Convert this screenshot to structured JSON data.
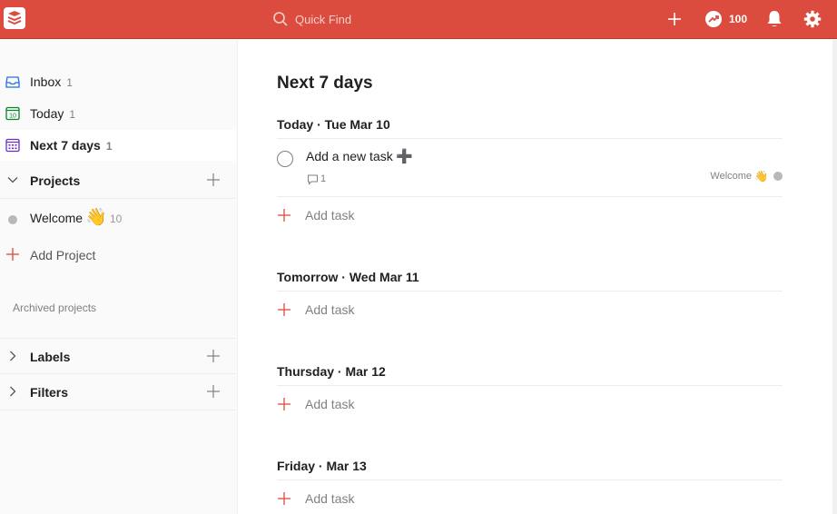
{
  "search": {
    "placeholder": "Quick Find"
  },
  "karma": {
    "count": "100"
  },
  "sidebar": {
    "items": [
      {
        "label": "Inbox",
        "count": "1"
      },
      {
        "label": "Today",
        "count": "1",
        "date_icon": "10"
      },
      {
        "label": "Next 7 days",
        "count": "1"
      }
    ],
    "projects_label": "Projects",
    "projects": [
      {
        "label": "Welcome",
        "emoji": "👋",
        "count": "10"
      }
    ],
    "add_project_label": "Add Project",
    "archived_label": "Archived projects",
    "labels_label": "Labels",
    "filters_label": "Filters"
  },
  "main": {
    "title": "Next 7 days",
    "days": [
      {
        "header": "Today · Tue Mar 10"
      },
      {
        "header": "Tomorrow · Wed Mar 11"
      },
      {
        "header": "Thursday · Mar 12"
      },
      {
        "header": "Friday · Mar 13"
      }
    ],
    "add_task_label": "Add task",
    "task": {
      "content": "Add a new task",
      "emoji": "➕",
      "comment_count": "1",
      "project": "Welcome",
      "project_emoji": "👋"
    }
  },
  "colors": {
    "brand": "#db4c3f",
    "project_dot": "#b8b8b8"
  },
  "icons": [
    "todoist-logo-icon",
    "search-icon",
    "plus-icon",
    "karma-icon",
    "bell-icon",
    "gear-icon",
    "inbox-icon",
    "calendar-today-icon",
    "calendar-week-icon",
    "chevron-down-icon",
    "chevron-right-icon",
    "comment-icon"
  ]
}
